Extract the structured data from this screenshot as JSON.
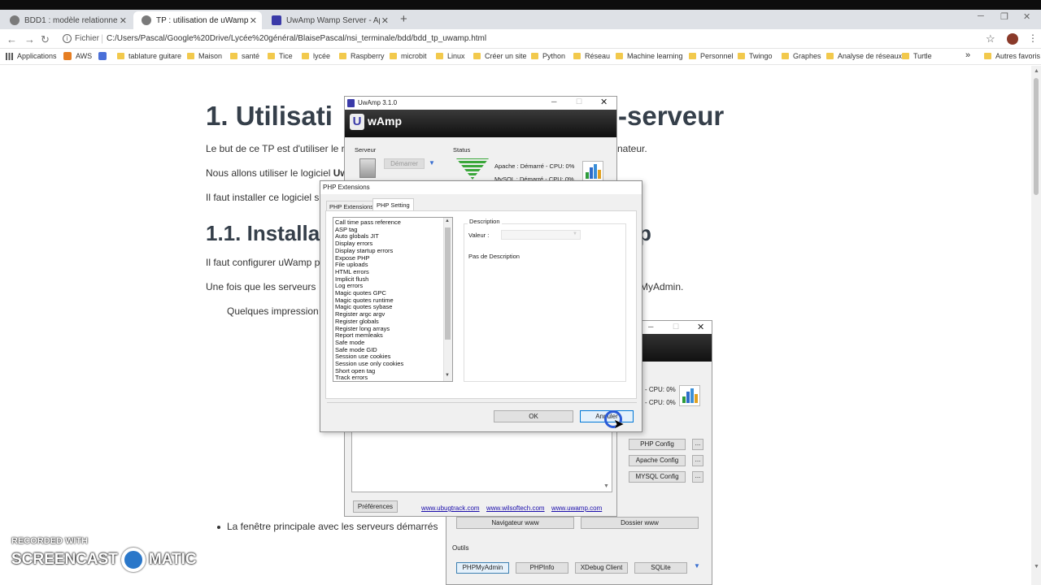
{
  "browser": {
    "tabs": [
      {
        "title": "BDD1 : modèle relationnel, clé.ac",
        "active": false
      },
      {
        "title": "TP : utilisation de uWamp",
        "active": true
      },
      {
        "title": "UwAmp Wamp Server - Apache",
        "active": false
      }
    ],
    "new_tab": "+",
    "address_prefix": "Fichier",
    "address": "C:/Users/Pascal/Google%20Drive/Lycée%20général/BlaisePascal/nsi_terminale/bdd/bdd_tp_uwamp.html",
    "bookmarks": [
      "Applications",
      "AWS",
      "tablature guitare",
      "Maison",
      "santé",
      "Tice",
      "lycée",
      "Raspberry",
      "microbit",
      "Linux",
      "Créer un site",
      "Python",
      "Réseau",
      "Machine learning",
      "Personnel",
      "Twingo",
      "Graphes",
      "Analyse de réseaux",
      "Turtle"
    ],
    "more_bookmarks": "»",
    "other_bookmarks": "Autres favoris"
  },
  "page": {
    "h1": "1. Utilisati",
    "h1_tail": "-serveur",
    "p1": "Le but de ce TP est d'utiliser le r",
    "p1_tail": "nateur.",
    "p2": "Nous allons utiliser le logiciel ",
    "p2_bold": "Uw",
    "p3": "Il faut installer ce logiciel s",
    "h2": "1.1. Installa",
    "h2_tail": "p",
    "p4": "Il faut configurer uWamp p",
    "p5": "Une fois que les serveurs ",
    "p5_tail": "MyAdmin.",
    "p6": "Quelques impression",
    "bullet": "La fenêtre principale avec les serveurs démarrés"
  },
  "uwamp": {
    "title": "UwAmp 3.1.0",
    "brand": "wAmp",
    "serveur_label": "Serveur",
    "status_label": "Status",
    "start_btn": "Démarrer",
    "apache_status": "Apache :   Démarré - CPU: 0%",
    "mysql_status": "MySQL :   Démarré - CPU: 0%",
    "cpu1": "- CPU: 0%",
    "cpu2": "- CPU: 0%",
    "php_config": "PHP Config",
    "apache_config": "Apache Config",
    "mysql_config": "MYSQL Config",
    "dots": "...",
    "preferences": "Préférences",
    "links": [
      "www.ubugtrack.com",
      "www.wilsoftech.com",
      "www.uwamp.com"
    ],
    "navigateur": "Navigateur www",
    "dossier": "Dossier www",
    "outils": "Outils",
    "tools": [
      "PHPMyAdmin",
      "PHPInfo",
      "XDebug Client",
      "SQLite"
    ]
  },
  "php_dialog": {
    "title": "PHP Extensions",
    "tabs": [
      "PHP Extensions",
      "PHP Setting"
    ],
    "active_tab": "PHP Setting",
    "settings": [
      "Call time pass reference",
      "ASP tag",
      "Auto globals JIT",
      "Display errors",
      "Display startup errors",
      "Expose PHP",
      "File uploads",
      "HTML errors",
      "Implicit flush",
      "Log errors",
      "Magic quotes GPC",
      "Magic quotes runtime",
      "Magic quotes sybase",
      "Register argc argv",
      "Register globals",
      "Register long arrays",
      "Report memleaks",
      "Safe mode",
      "Safe mode GID",
      "Session use cookies",
      "Session use only cookies",
      "Short open tag",
      "Track errors"
    ],
    "description_label": "Description",
    "valeur_label": "Valeur :",
    "no_description": "Pas de Description",
    "ok": "OK",
    "cancel": "Annuler"
  },
  "watermark": {
    "line1": "RECORDED WITH",
    "line2": "SCREENCAST",
    "line3": "MATIC"
  }
}
